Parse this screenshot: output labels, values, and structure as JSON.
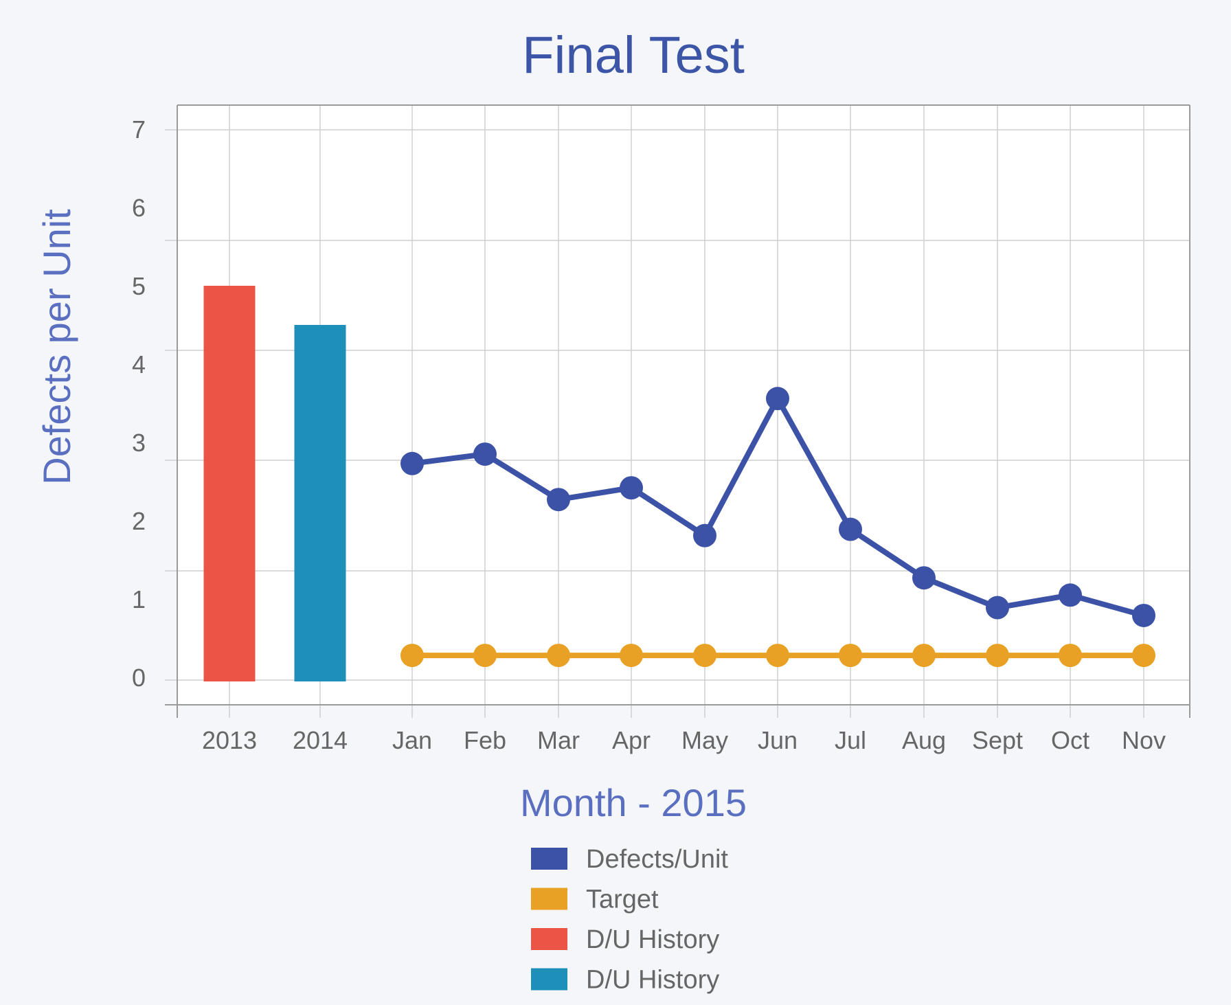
{
  "chart_data": {
    "type": "line",
    "title": "Final Test",
    "xlabel": "Month - 2015",
    "ylabel": "Defects per Unit",
    "ylim": [
      0,
      7
    ],
    "yticks": [
      "0",
      "1",
      "2",
      "3",
      "4",
      "5",
      "6",
      "7"
    ],
    "grid": true,
    "legend_position": "bottom",
    "categories": [
      "2013",
      "2014",
      "Jan",
      "Feb",
      "Mar",
      "Apr",
      "May",
      "Jun",
      "Jul",
      "Aug",
      "Sept",
      "Oct",
      "Nov"
    ],
    "series": [
      {
        "name": "Defects/Unit",
        "kind": "line",
        "color": "#3c52a7",
        "x": [
          "Jan",
          "Feb",
          "Mar",
          "Apr",
          "May",
          "Jun",
          "Jul",
          "Aug",
          "Sept",
          "Oct",
          "Nov"
        ],
        "values": [
          2.73,
          2.85,
          2.27,
          2.42,
          1.81,
          3.56,
          1.89,
          1.27,
          0.89,
          1.05,
          0.79
        ]
      },
      {
        "name": "Target",
        "kind": "line",
        "color": "#e8a124",
        "x": [
          "Jan",
          "Feb",
          "Mar",
          "Apr",
          "May",
          "Jun",
          "Jul",
          "Aug",
          "Sept",
          "Oct",
          "Nov"
        ],
        "values": [
          0.28,
          0.28,
          0.28,
          0.28,
          0.28,
          0.28,
          0.28,
          0.28,
          0.28,
          0.28,
          0.28
        ]
      },
      {
        "name": "D/U History",
        "kind": "bar",
        "color": "#ea5545",
        "x": [
          "2013"
        ],
        "values": [
          5.0
        ]
      },
      {
        "name": "D/U History",
        "kind": "bar",
        "color": "#1e8fb9",
        "x": [
          "2014"
        ],
        "values": [
          4.5
        ]
      }
    ]
  }
}
